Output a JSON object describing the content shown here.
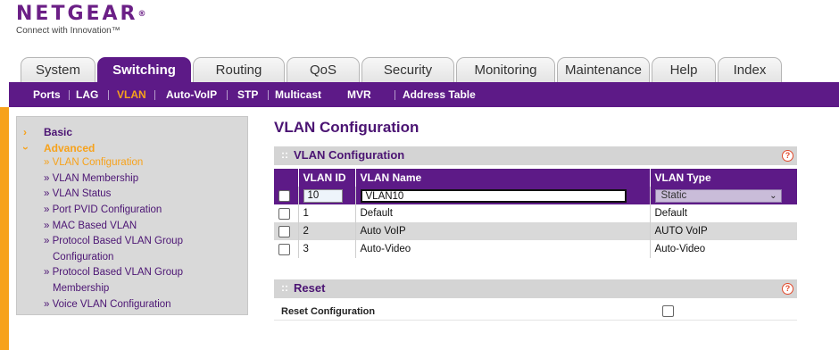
{
  "brand": {
    "name": "NETGEAR",
    "reg_mark": "®",
    "tagline": "Connect with Innovation™"
  },
  "tabs": [
    "System",
    "Switching",
    "Routing",
    "QoS",
    "Security",
    "Monitoring",
    "Maintenance",
    "Help",
    "Index"
  ],
  "active_tab": "Switching",
  "subnav": [
    "Ports",
    "LAG",
    "VLAN",
    "Auto-VoIP",
    "STP",
    "Multicast",
    "MVR",
    "Address Table"
  ],
  "active_subnav": "VLAN",
  "sidebar": {
    "basic": "Basic",
    "advanced": "Advanced",
    "arrow_glyph": "›",
    "items": [
      "» VLAN Configuration",
      "» VLAN Membership",
      "» VLAN Status",
      "» Port PVID Configuration",
      "» MAC Based VLAN",
      "» Protocol Based VLAN Group",
      "Configuration",
      "» Protocol Based VLAN Group",
      "Membership",
      "» Voice VLAN Configuration"
    ]
  },
  "page_title": "VLAN Configuration",
  "vlan_section": {
    "title": "VLAN Configuration",
    "grip": "::",
    "help": "?",
    "columns": [
      "",
      "VLAN ID",
      "VLAN Name",
      "VLAN Type"
    ],
    "edit_row": {
      "vlan_id": "10",
      "vlan_name": "VLAN10",
      "vlan_type": "Static",
      "chevron": "⌄"
    },
    "rows": [
      {
        "vlan_id": "1",
        "vlan_name": "Default",
        "vlan_type": "Default"
      },
      {
        "vlan_id": "2",
        "vlan_name": "Auto VoIP",
        "vlan_type": "AUTO VoIP"
      },
      {
        "vlan_id": "3",
        "vlan_name": "Auto-Video",
        "vlan_type": "Auto-Video"
      }
    ]
  },
  "reset_section": {
    "title": "Reset",
    "grip": "::",
    "help": "?",
    "label": "Reset Configuration"
  },
  "colors": {
    "purple": "#5d1a87",
    "orange": "#f7a21b",
    "gray": "#d9d9d9"
  }
}
